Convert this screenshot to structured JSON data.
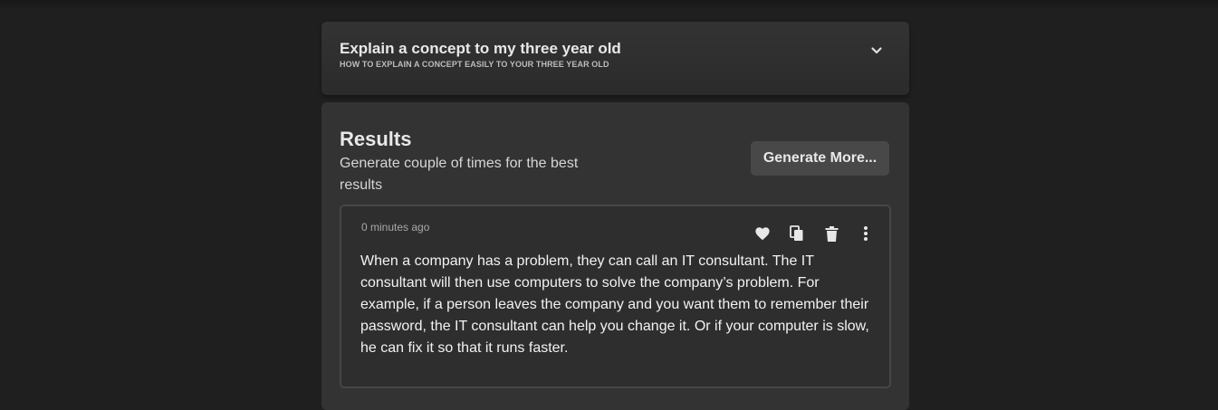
{
  "accordion": {
    "title": "Explain a concept to my three year old",
    "subtitle": "HOW TO EXPLAIN A CONCEPT EASILY TO YOUR THREE YEAR OLD",
    "chevron_icon": "chevron-down-icon"
  },
  "results": {
    "title": "Results",
    "subtitle": "Generate couple of times for the best results",
    "generate_label": "Generate More..."
  },
  "result_card": {
    "timestamp": "0 minutes ago",
    "actions": [
      "heart-icon",
      "copy-icon",
      "trash-icon",
      "more-vertical-icon"
    ],
    "text": "When a company has a problem, they can call an IT consultant. The IT consultant will then use computers to solve the company’s problem. For example, if a person leaves the company and you want them to remember their password, the IT consultant can help you change it. Or if your computer is slow, he can fix it so that it runs faster."
  },
  "colors": {
    "page_background": "#1f1f1f",
    "panel_background": "#333333",
    "button_background": "#484848",
    "card_border": "#464646"
  }
}
